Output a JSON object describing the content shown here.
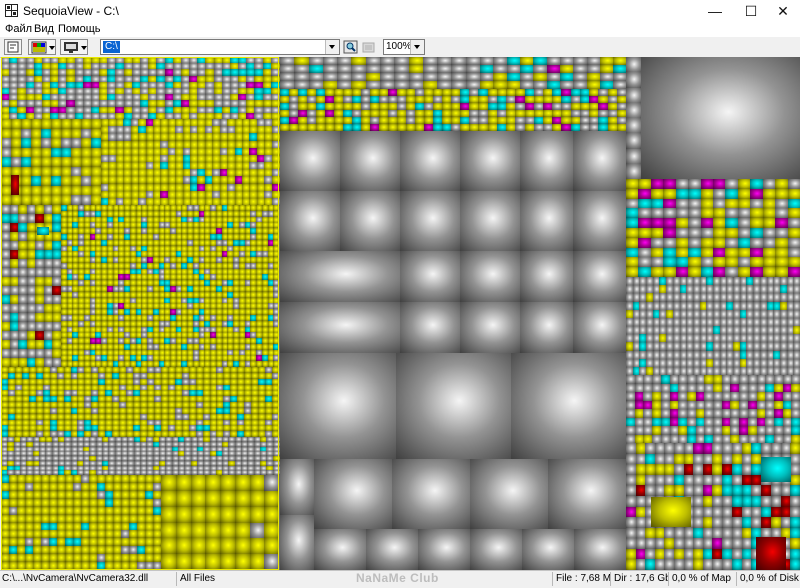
{
  "window": {
    "title": "SequoiaView - C:\\"
  },
  "title_buttons": [
    {
      "name": "minimize-button",
      "glyph": "—"
    },
    {
      "name": "maximize-button",
      "glyph": "☐"
    },
    {
      "name": "close-button",
      "glyph": "✕"
    }
  ],
  "menu": {
    "items": [
      "Файл",
      "Вид",
      "Помощь"
    ]
  },
  "toolbar": {
    "path_value": "C:\\",
    "zoom_value": "100%",
    "icons": [
      "properties-icon",
      "colors-icon",
      "display-mode-icon",
      "zoom-in-icon",
      "zoom-out-icon"
    ]
  },
  "statusbar": {
    "path": "C:\\...\\NvCamera\\NvCamera32.dll",
    "filter": "All Files",
    "watermark": "NaNaMe Club",
    "file_size": "File : 7,68 Mb",
    "dir_size": "Dir : 17,6 Gb",
    "map_percent": "0,0 % of Map",
    "disk_percent": "0,0 % of Disk"
  },
  "colors": {
    "yellow": "#b4b400",
    "cyan": "#00b4b4",
    "magenta": "#a0008c",
    "gray": "#8c8c8c",
    "red": "#8c0000",
    "selection": "#0a64d2"
  }
}
